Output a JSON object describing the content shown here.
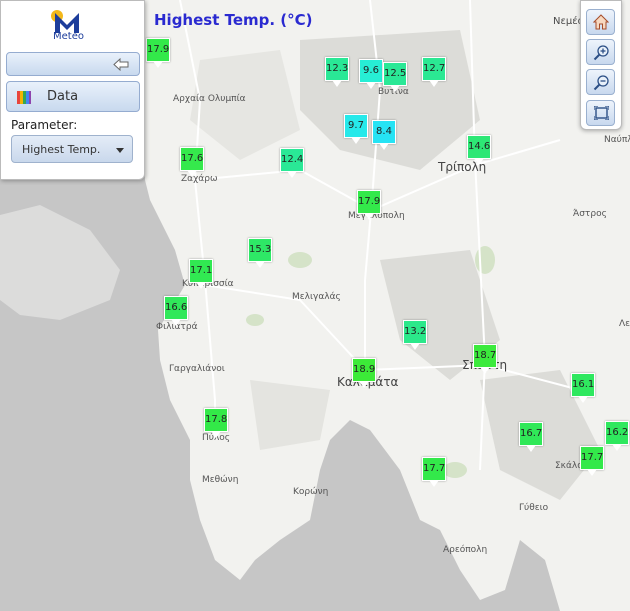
{
  "map": {
    "title": "Highest Temp. (°C)",
    "colors": {
      "sea": "#c6c6c6",
      "land": "#f2f2ef",
      "terrain": "#d9d9d6",
      "roads": "#ffffff",
      "forest": "#d5e3c8"
    },
    "place_labels": [
      "Νεμέα",
      "Αρχαία Ολυμπία",
      "Βυτίνα",
      "Τρίπολη",
      "Ναύπλ",
      "Ζαχάρω",
      "Μεγαλόπολη",
      "Άστρος",
      "Κυπαρισσία",
      "Μελιγαλάς",
      "Φιλιατρά",
      "Λε",
      "Γαργαλιάνοι",
      "Σπάρτη",
      "Καλαμάτα",
      "Πύλος",
      "Σκάλα",
      "Μεθώνη",
      "Κορώνη",
      "Γύθειο",
      "Αρεόπολη"
    ],
    "stations": [
      {
        "value": "17.9",
        "color": "#33e94a"
      },
      {
        "value": "12.3",
        "color": "#2ae896"
      },
      {
        "value": "9.6",
        "color": "#27eed5"
      },
      {
        "value": "12.5",
        "color": "#2ae896"
      },
      {
        "value": "12.7",
        "color": "#2be893"
      },
      {
        "value": "9.7",
        "color": "#26e9ea"
      },
      {
        "value": "8.4",
        "color": "#26e3f4"
      },
      {
        "value": "17.6",
        "color": "#35e94c"
      },
      {
        "value": "12.4",
        "color": "#2ae896"
      },
      {
        "value": "14.6",
        "color": "#2de775"
      },
      {
        "value": "17.9",
        "color": "#33e94a"
      },
      {
        "value": "15.3",
        "color": "#2ee866"
      },
      {
        "value": "17.1",
        "color": "#31e952"
      },
      {
        "value": "16.6",
        "color": "#30e85a"
      },
      {
        "value": "13.2",
        "color": "#2be88a"
      },
      {
        "value": "18.7",
        "color": "#3bea3c"
      },
      {
        "value": "18.9",
        "color": "#3cea38"
      },
      {
        "value": "16.1",
        "color": "#2fe85f"
      },
      {
        "value": "17.8",
        "color": "#33e948"
      },
      {
        "value": "16.7",
        "color": "#30e858"
      },
      {
        "value": "16.2",
        "color": "#2fe85e"
      },
      {
        "value": "17.7",
        "color": "#33e94a"
      },
      {
        "value": "17.7",
        "color": "#33e94a"
      }
    ]
  },
  "panel": {
    "logo_text": "Meteo",
    "collapse_icon": "arrow-left-icon",
    "data_button_label": "Data",
    "data_icon": "color-palette-icon",
    "parameter_label": "Parameter:",
    "parameter_value": "Highest Temp."
  },
  "toolbar": {
    "icons": [
      "home-icon",
      "zoom-in-icon",
      "zoom-out-icon",
      "fullscreen-icon"
    ]
  }
}
